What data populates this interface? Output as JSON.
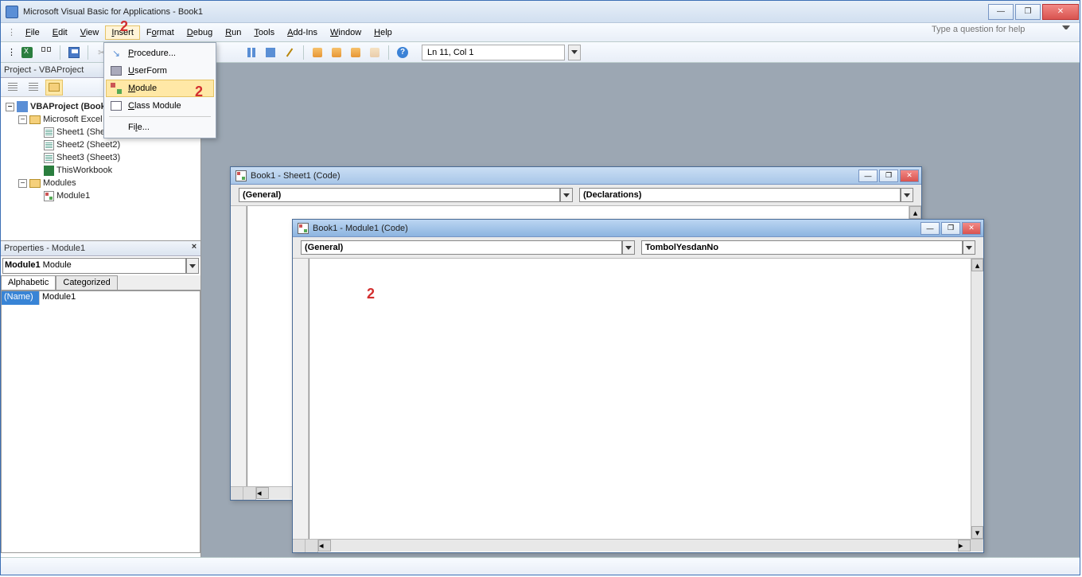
{
  "window": {
    "title": "Microsoft Visual Basic for Applications - Book1"
  },
  "menubar": {
    "file": "File",
    "edit": "Edit",
    "view": "View",
    "insert": "Insert",
    "format": "Format",
    "debug": "Debug",
    "run": "Run",
    "tools": "Tools",
    "addins": "Add-Ins",
    "window": "Window",
    "help": "Help",
    "askPlaceholder": "Type a question for help"
  },
  "toolbar": {
    "cursorpos": "Ln 11, Col 1"
  },
  "insertMenu": {
    "procedure": "Procedure...",
    "userform": "UserForm",
    "module": "Module",
    "classmodule": "Class Module",
    "file": "File..."
  },
  "projectPane": {
    "title": "Project - VBAProject",
    "root": "VBAProject (Book1)",
    "excelObjects": "Microsoft Excel Objects",
    "sheet1": "Sheet1 (Sheet1)",
    "sheet2": "Sheet2 (Sheet2)",
    "sheet3": "Sheet3 (Sheet3)",
    "thisworkbook": "ThisWorkbook",
    "modulesFolder": "Modules",
    "module1": "Module1"
  },
  "propertiesPane": {
    "title": "Properties - Module1",
    "selectorBold": "Module1",
    "selectorRest": " Module",
    "tabAlpha": "Alphabetic",
    "tabCat": "Categorized",
    "propName": "(Name)",
    "propValue": "Module1"
  },
  "childSheet": {
    "title": "Book1 - Sheet1 (Code)",
    "ddLeft": "(General)",
    "ddRight": "(Declarations)"
  },
  "childModule": {
    "title": "Book1 - Module1 (Code)",
    "ddLeft": "(General)",
    "ddRight": "TombolYesdanNo"
  },
  "annotations": {
    "a1": "2",
    "a2": "2",
    "a3": "2"
  }
}
